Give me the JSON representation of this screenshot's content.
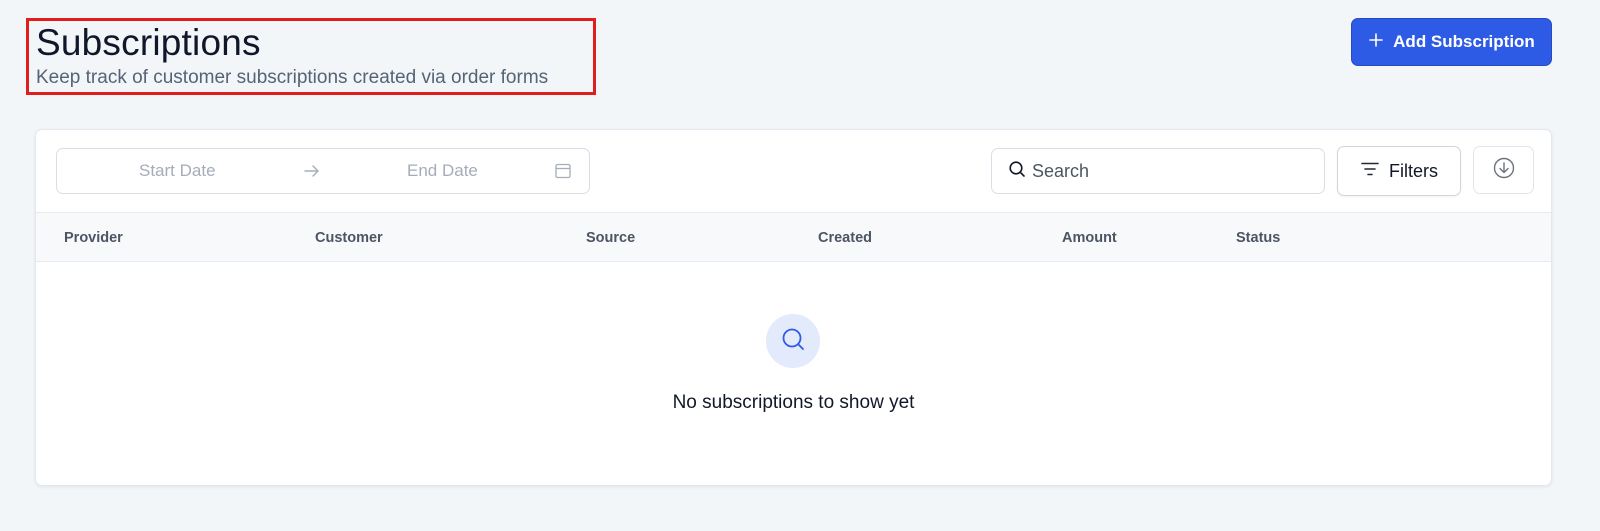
{
  "header": {
    "title": "Subscriptions",
    "subtitle": "Keep track of customer subscriptions created via order forms",
    "add_button_label": "Add Subscription"
  },
  "toolbar": {
    "date_range": {
      "start_placeholder": "Start Date",
      "end_placeholder": "End Date"
    },
    "search_placeholder": "Search",
    "filters_label": "Filters"
  },
  "table": {
    "columns": [
      "Provider",
      "Customer",
      "Source",
      "Created",
      "Amount",
      "Status"
    ],
    "empty_message": "No subscriptions to show yet"
  },
  "colors": {
    "accent": "#2e5be6",
    "highlight_border": "#e01e1e",
    "empty_icon_bg": "#e3eafb"
  },
  "icons": {
    "add": "plus-icon",
    "date_arrow": "arrow-right-icon",
    "calendar": "calendar-icon",
    "search": "search-icon",
    "filters": "filter-lines-icon",
    "download": "download-circle-icon",
    "empty": "search-icon"
  }
}
